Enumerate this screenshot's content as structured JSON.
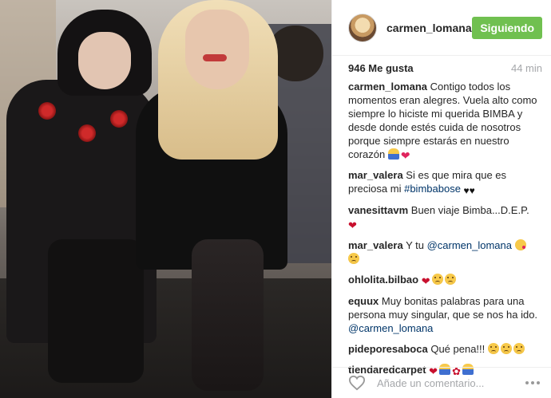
{
  "post": {
    "image_icon": "photo-two-women-fashion-show"
  },
  "header": {
    "username": "carmen_lomana",
    "follow_label": "Siguiendo",
    "follow_color": "#70c050"
  },
  "stats": {
    "likes": "946 Me gusta",
    "time": "44 min"
  },
  "comments": [
    {
      "user": "carmen_lomana",
      "text": "Contigo todos los momentos eran alegres. Vuela alto como siempre lo hiciste mi querida BIMBA y desde donde estés cuida de nosotros porque siempre estarás en nuestro corazón"
    },
    {
      "user": "mar_valera",
      "text": "Si es que mira que es preciosa mi",
      "tag": "#bimbabose"
    },
    {
      "user": "vanesittavm",
      "text": "Buen viaje Bimba...D.E.P."
    },
    {
      "user": "mar_valera",
      "text": "Y tu",
      "mention": "@carmen_lomana"
    },
    {
      "user": "ohlolita.bilbao",
      "text": ""
    },
    {
      "user": "equux",
      "text": "Muy bonitas palabras para una persona muy singular, que se nos ha ido.",
      "mention": "@carmen_lomana"
    },
    {
      "user": "pideporesaboca",
      "text": "Qué pena!!!"
    },
    {
      "user": "tiendaredcarpet",
      "text": ""
    }
  ],
  "footer": {
    "like_icon": "heart-outline-icon",
    "comment_placeholder": "Añade un comentario...",
    "more_icon": "more-dots-icon"
  }
}
